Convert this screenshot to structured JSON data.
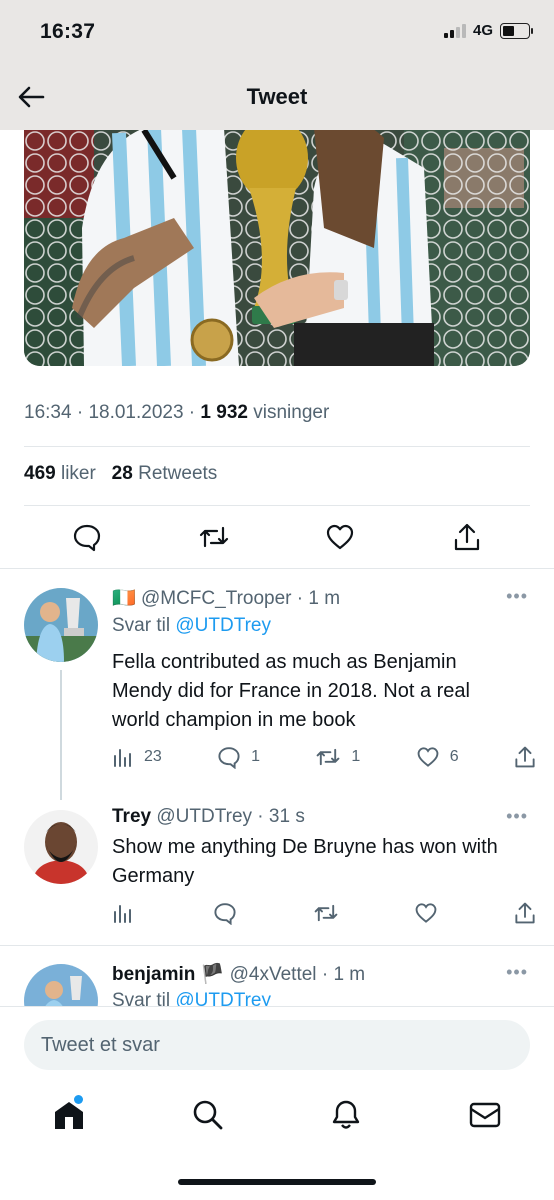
{
  "status_bar": {
    "time": "16:37",
    "network": "4G"
  },
  "header": {
    "title": "Tweet"
  },
  "tweet": {
    "time": "16:34",
    "date": "18.01.2023",
    "views_count": "1 932",
    "views_label": "visninger",
    "likes_count": "469",
    "likes_label": "liker",
    "retweets_count": "28",
    "retweets_label": "Retweets"
  },
  "replies": [
    {
      "flag": "🇮🇪",
      "handle": "@MCFC_Trooper",
      "time": "1 m",
      "replying_label": "Svar til",
      "replying_to": "@UTDTrey",
      "text": "Fella contributed as much as Benjamin Mendy did for France in 2018. Not a real world champion in me book",
      "views": "23",
      "replies": "1",
      "retweets": "1",
      "likes": "6"
    },
    {
      "name": "Trey",
      "handle": "@UTDTrey",
      "time": "31 s",
      "text": "Show me anything De Bruyne has won with Germany"
    },
    {
      "name": "benjamin",
      "flag": "🏴",
      "handle": "@4xVettel",
      "time": "1 m",
      "replying_label": "Svar til",
      "replying_to": "@UTDTrey"
    }
  ],
  "compose": {
    "placeholder": "Tweet et svar"
  },
  "colors": {
    "accent": "#1d9bf0",
    "text": "#0f1419",
    "secondary": "#536471"
  }
}
